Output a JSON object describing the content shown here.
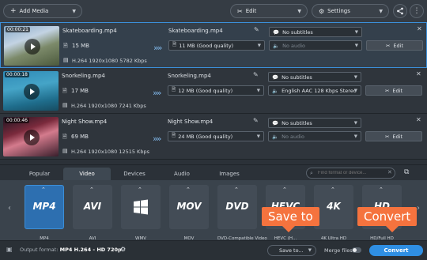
{
  "toolbar": {
    "add_media_label": "Add Media",
    "edit_label": "Edit",
    "settings_label": "Settings"
  },
  "files": [
    {
      "duration": "00:00:21",
      "name": "Skateboarding.mp4",
      "size": "15 MB",
      "spec": "H.264 1920x1080 5782 Kbps",
      "output_name": "Skateboarding.mp4",
      "output_size": "11 MB (Good quality)",
      "subtitles": "No subtitles",
      "audio": "No audio",
      "edit_label": "Edit"
    },
    {
      "duration": "00:00:18",
      "name": "Snorkeling.mp4",
      "size": "17 MB",
      "spec": "H.264 1920x1080 7241 Kbps",
      "output_name": "Snorkeling.mp4",
      "output_size": "12 MB (Good quality)",
      "subtitles": "No subtitles",
      "audio": "English AAC 128 Kbps Stereo",
      "edit_label": "Edit"
    },
    {
      "duration": "00:00:46",
      "name": "Night Show.mp4",
      "size": "69 MB",
      "spec": "H.264 1920x1080 12515 Kbps",
      "output_name": "Night Show.mp4",
      "output_size": "24 MB (Good quality)",
      "subtitles": "No subtitles",
      "audio": "No audio",
      "edit_label": "Edit"
    }
  ],
  "tabs": [
    "Popular",
    "Video",
    "Devices",
    "Audio",
    "Images"
  ],
  "search_placeholder": "Find format or device...",
  "formats": [
    {
      "logo": "MP4",
      "label": "MP4"
    },
    {
      "logo": "AVI",
      "label": "AVI"
    },
    {
      "logo": "",
      "label": "WMV"
    },
    {
      "logo": "MOV",
      "label": "MOV"
    },
    {
      "logo": "DVD",
      "label": "DVD-Compatible Video"
    },
    {
      "logo": "HEVC",
      "label": "HEVC (H..."
    },
    {
      "logo": "4K",
      "label": "4K Ultra HD"
    },
    {
      "logo": "HD",
      "label": "HD/Full HD"
    }
  ],
  "bottom": {
    "output_format_label": "Output format:",
    "output_format_value": "MP4 H.264 - HD 720p",
    "save_to_label": "Save to...",
    "merge_label": "Merge files:",
    "convert_label": "Convert"
  },
  "callouts": {
    "save_to": "Save to",
    "convert": "Convert"
  },
  "colors": {
    "accent": "#2f8fe3",
    "callout": "#f5733e",
    "selection": "#3b8fd9"
  }
}
